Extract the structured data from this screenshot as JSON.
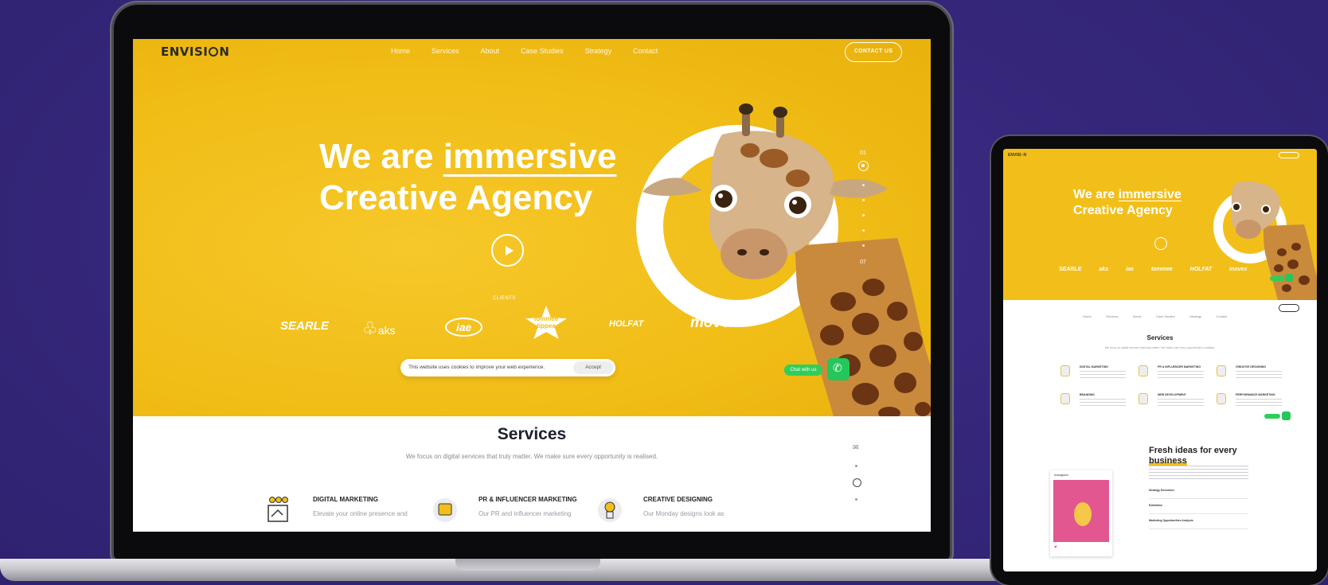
{
  "laptop": {
    "logo": {
      "prefix": "ENVISI",
      "suffix": "N"
    },
    "nav": [
      "Home",
      "Services",
      "About",
      "Case Studies",
      "Strategy",
      "Contact"
    ],
    "contact_button": "CONTACT US",
    "hero": {
      "line1_prefix": "We are ",
      "line1_accent": "immersive",
      "line2": "Creative Agency",
      "slide_first": "01",
      "slide_last": "07",
      "clients_label": "CLIENTS"
    },
    "clients": [
      "SEARLE",
      "aks",
      "iae",
      "tommee tippee",
      "HOLFAT",
      "movex"
    ],
    "cookie": {
      "text": "This website uses cookies to improve your web experience.",
      "accept": "Accept"
    },
    "chat_label": "Chat with us",
    "services": {
      "title": "Services",
      "subtitle": "We focus on digital services that truly matter. We make sure every opportunity is realised.",
      "items": [
        {
          "title": "DIGITAL MARKETING",
          "desc": "Elevate your online presence and"
        },
        {
          "title": "PR & INFLUENCER MARKETING",
          "desc": "Our PR and influencer marketing"
        },
        {
          "title": "CREATIVE DESIGNING",
          "desc": "Our Monday designs look as"
        }
      ]
    }
  },
  "tablet": {
    "hero": {
      "line1_prefix": "We are ",
      "line1_accent": "immersive",
      "line2": "Creative Agency"
    },
    "clients": [
      "SEARLE",
      "aks",
      "iae",
      "tommee",
      "HOLFAT",
      "movex"
    ],
    "services_title": "Services",
    "services": [
      "DIGITAL MARKETING",
      "PR & INFLUENCER MARKETING",
      "CREATIVE DESIGNING",
      "BRANDING",
      "WEB DEVELOPMENT",
      "PERFORMANCE MARKETING"
    ],
    "post_header": "Instagram",
    "fresh_line1": "Fresh ideas for every",
    "fresh_line2": "business",
    "accordion": [
      "Strategy Execution",
      "Exhibition",
      "Marketing Opportunities Analysis"
    ]
  },
  "colors": {
    "background": "#35267a",
    "brand_yellow": "#f2bf1a",
    "whatsapp_green": "#25c65a"
  }
}
